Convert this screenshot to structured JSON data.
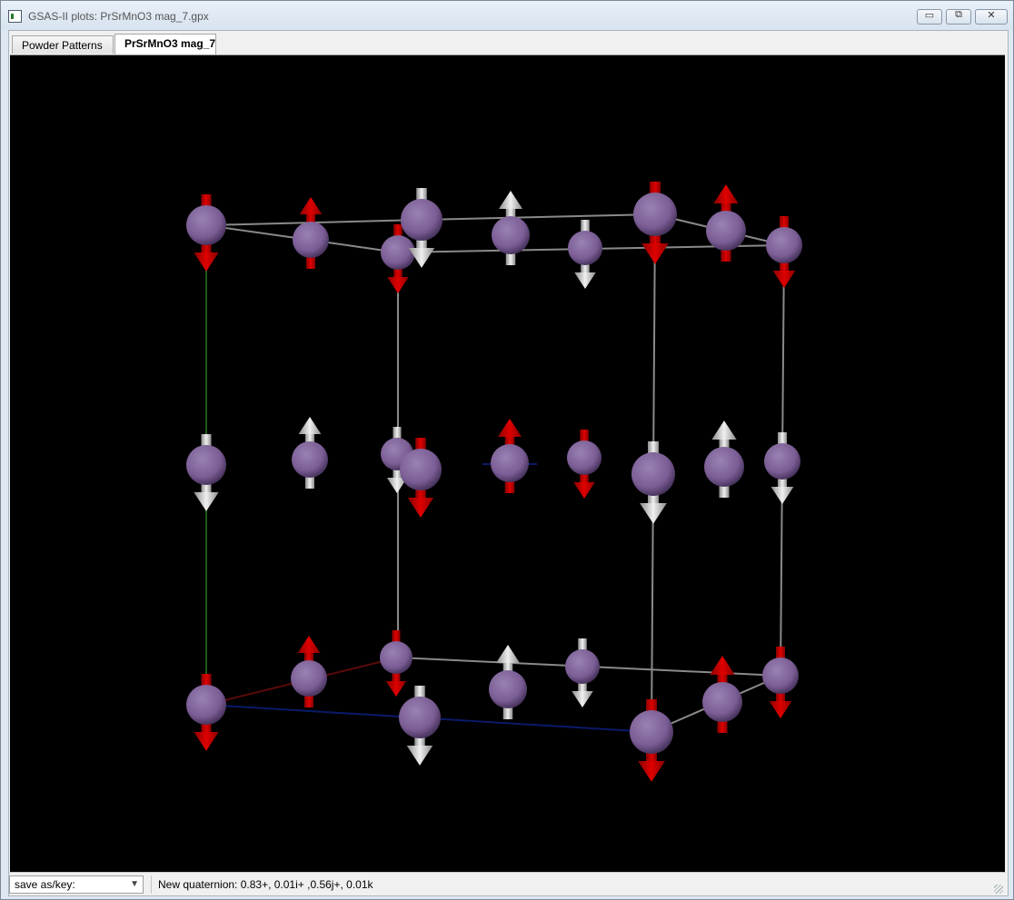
{
  "window": {
    "title": "GSAS-II plots: PrSrMnO3 mag_7.gpx",
    "minimize_glyph": "▭",
    "maximize_glyph": "⧉",
    "close_glyph": "✕"
  },
  "tabs": [
    {
      "label": "Powder Patterns",
      "selected": false
    },
    {
      "label": "PrSrMnO3 mag_7",
      "selected": true
    }
  ],
  "plot": {
    "background": "#000000",
    "atom_color": "#7a5d94",
    "spin_up_color": "#c00000",
    "spin_neutral_color": "#b8b8b8",
    "axis_colors": {
      "a": "#5a0a0a",
      "b": "#0a1a6a",
      "c": "#1e5a1e"
    }
  },
  "statusbar": {
    "save_select_value": "save as/key:",
    "message": "New quaternion: 0.83+, 0.01i+ ,0.56j+, 0.01k"
  }
}
